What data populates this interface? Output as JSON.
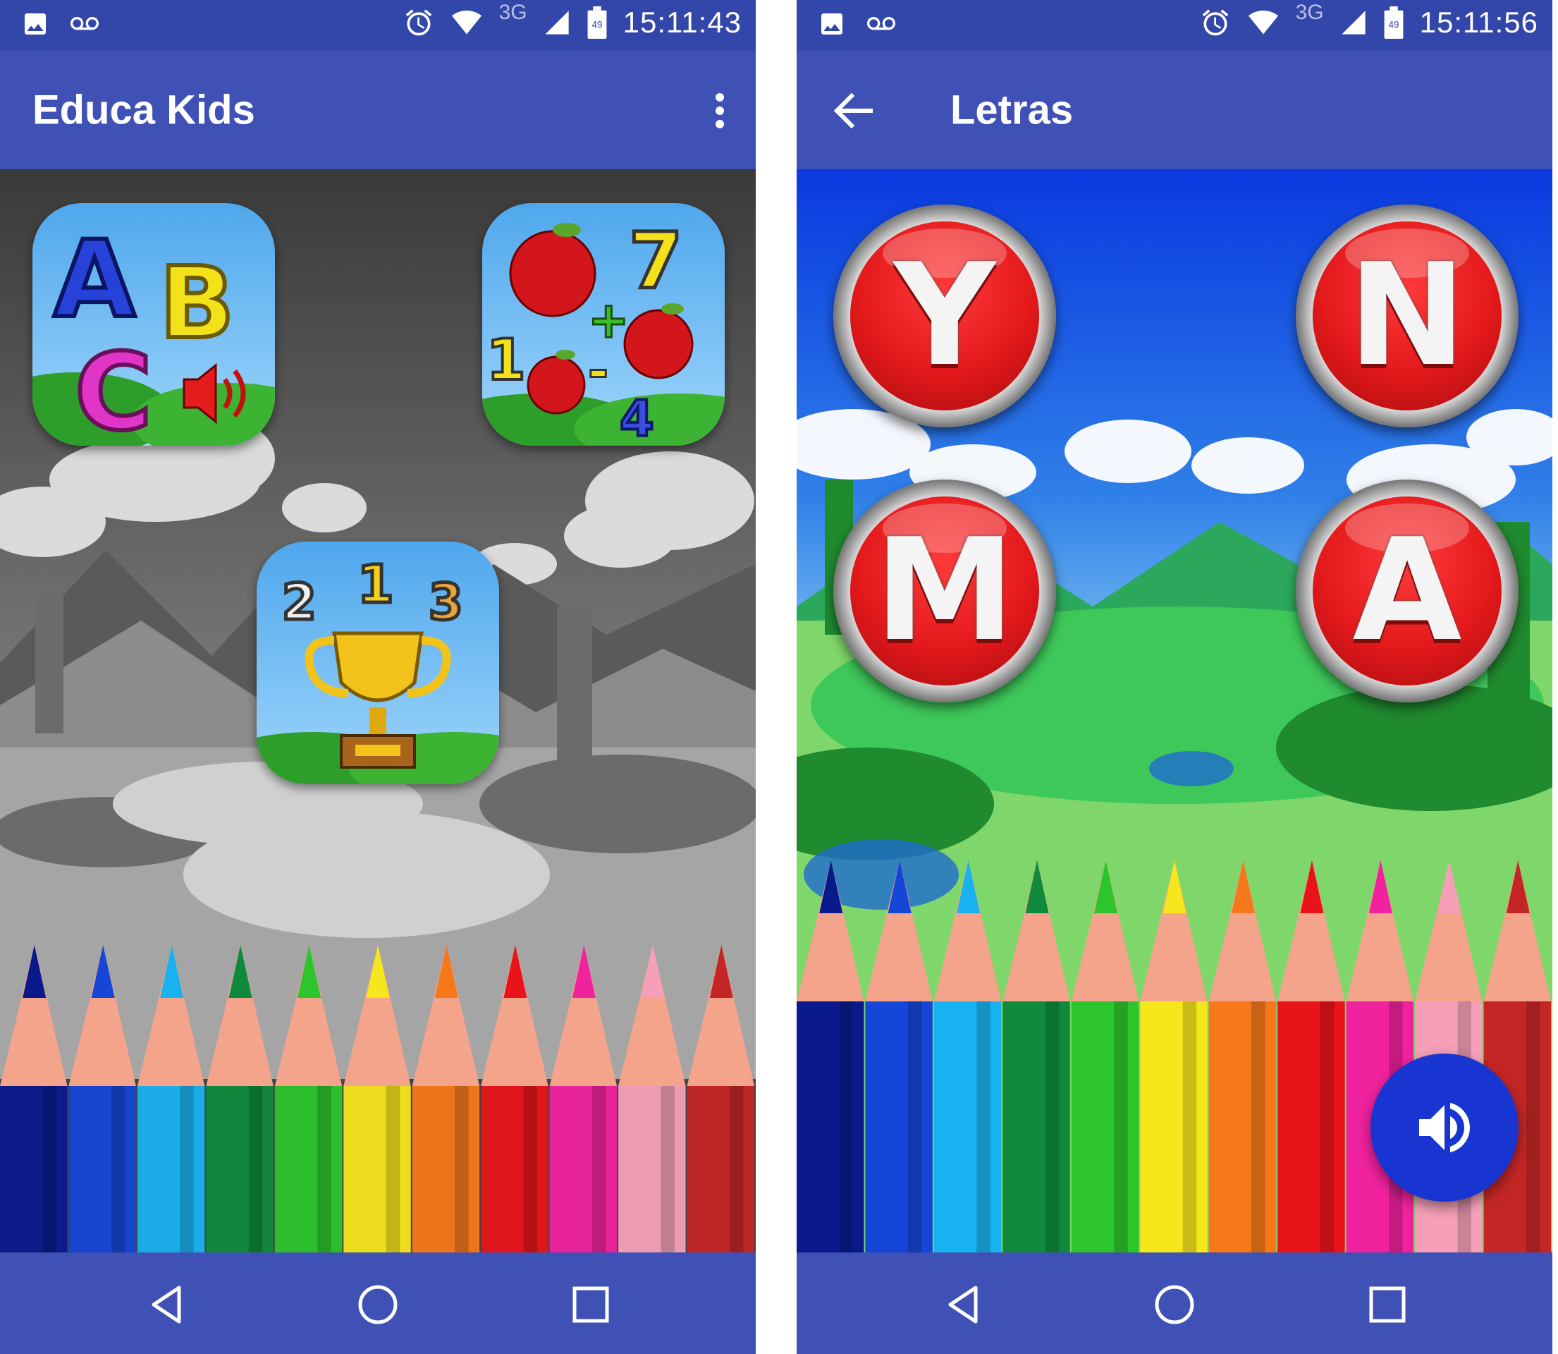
{
  "colors": {
    "status_bar": "#3346a9",
    "app_bar": "#3f51b5",
    "nav_bar": "#3f51b5",
    "fab": "#1834d1",
    "letter_button": "#e4191b"
  },
  "left_screen": {
    "status_bar": {
      "icons_left": [
        "image-icon",
        "voicemail-icon"
      ],
      "icons_right": [
        "alarm-icon",
        "wifi-icon",
        "signal-icon",
        "battery-icon"
      ],
      "network": "3G",
      "battery_level": "49",
      "time": "15:11:43"
    },
    "app_bar": {
      "title": "Educa Kids",
      "menu_icon": "more-vert-icon"
    },
    "background": "grayscale landscape with colored pencils",
    "tiles": [
      {
        "name": "letters",
        "icon": "abc-letters-icon"
      },
      {
        "name": "math",
        "icon": "apples-math-icon",
        "numbers": [
          "7",
          "1",
          "4"
        ]
      },
      {
        "name": "ranking",
        "icon": "trophy-icon",
        "numbers": [
          "2",
          "1",
          "3"
        ]
      }
    ],
    "nav_bar": [
      "back-icon",
      "home-icon",
      "recents-icon"
    ]
  },
  "right_screen": {
    "status_bar": {
      "icons_left": [
        "image-icon",
        "voicemail-icon"
      ],
      "icons_right": [
        "alarm-icon",
        "wifi-icon",
        "signal-icon",
        "battery-icon"
      ],
      "network": "3G",
      "battery_level": "49",
      "time": "15:11:56"
    },
    "app_bar": {
      "title": "Letras",
      "back_icon": "arrow-back-icon"
    },
    "letters": [
      "Y",
      "N",
      "M",
      "A"
    ],
    "fab_icon": "volume-up-icon",
    "nav_bar": [
      "back-icon",
      "home-icon",
      "recents-icon"
    ]
  }
}
